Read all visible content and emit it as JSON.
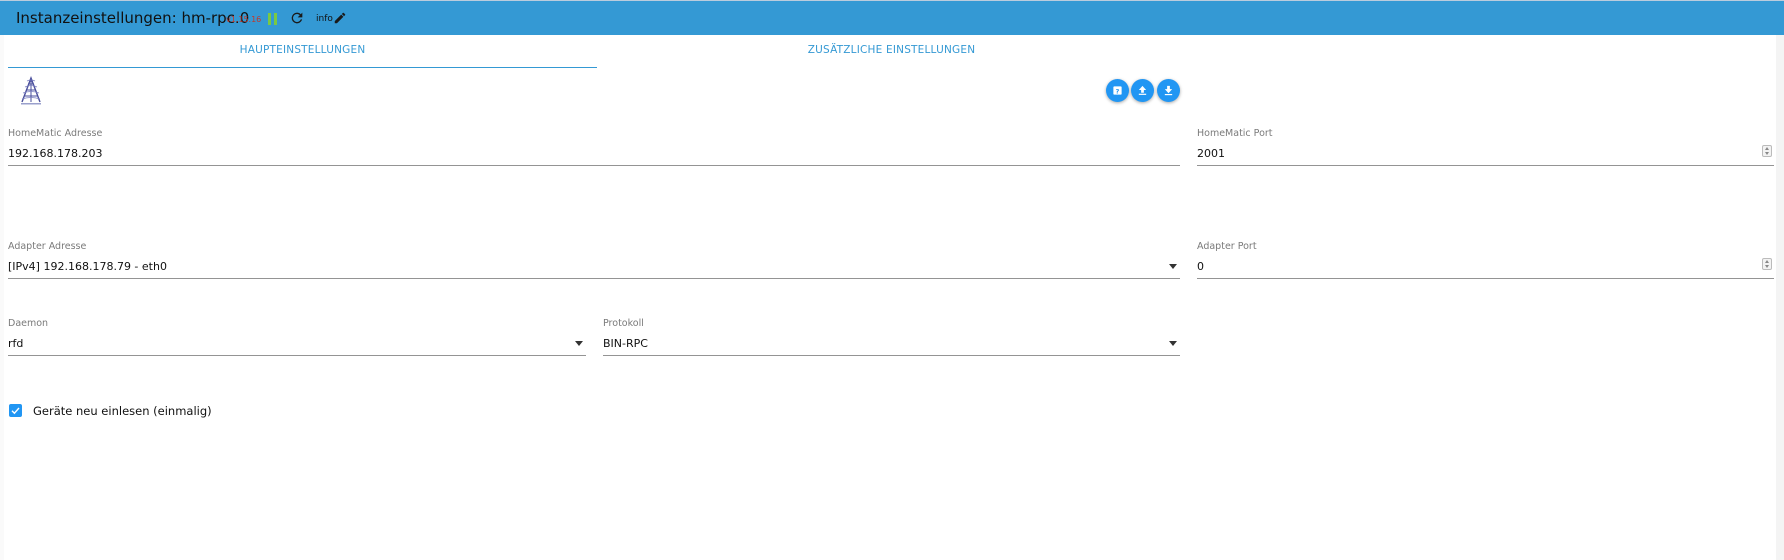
{
  "header": {
    "title": "Instanzeinstellungen: hm-rpc.0",
    "version": "v1.15.16",
    "info_label": "info"
  },
  "tabs": [
    {
      "label": "HAUPTEINSTELLUNGEN",
      "active": true
    },
    {
      "label": "ZUSÄTZLICHE EINSTELLUNGEN",
      "active": false
    }
  ],
  "actions": {
    "help_icon": "help-icon",
    "upload_icon": "upload-icon",
    "download_icon": "download-icon"
  },
  "fields": {
    "homematic_address": {
      "label": "HomeMatic Adresse",
      "value": "192.168.178.203"
    },
    "homematic_port": {
      "label": "HomeMatic Port",
      "value": "2001"
    },
    "adapter_address": {
      "label": "Adapter Adresse",
      "value": "[IPv4] 192.168.178.79 - eth0"
    },
    "adapter_port": {
      "label": "Adapter Port",
      "value": "0"
    },
    "daemon": {
      "label": "Daemon",
      "value": "rfd"
    },
    "protocol": {
      "label": "Protokoll",
      "value": "BIN-RPC"
    }
  },
  "checkbox": {
    "label": "Geräte neu einlesen (einmalig)",
    "checked": true
  },
  "colors": {
    "header": "#3499d4",
    "accent": "#2196f3",
    "version": "#c0392b",
    "pause": "#7ac943"
  }
}
